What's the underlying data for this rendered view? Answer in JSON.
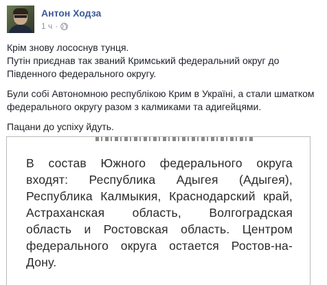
{
  "post": {
    "author": "Антон Ходза",
    "time": "1 ч",
    "separator": "·",
    "privacy_icon": "globe-icon",
    "paragraphs": [
      "Крім знову лососнув тунця.\nПутін приєднав так званий Кримський федеральний округ до Південного федерального округу.",
      "Були собі Автономною республікою Крим в Україні, а стали шматком федерального округу разом з калмиками та адигейцями.",
      "Пацани до успіху йдуть."
    ]
  },
  "attached_image": {
    "text": "В состав Южного федерального округа входят: Республика Адыгея (Адыгея), Республика Калмыкия, Краснодарский край, Астраханская область, Волгоградская область и Ростовская область. Центром федерального округа остается Ростов-на-Дону."
  },
  "colors": {
    "link": "#3b5998",
    "meta": "#90949c",
    "text": "#1d2129"
  }
}
